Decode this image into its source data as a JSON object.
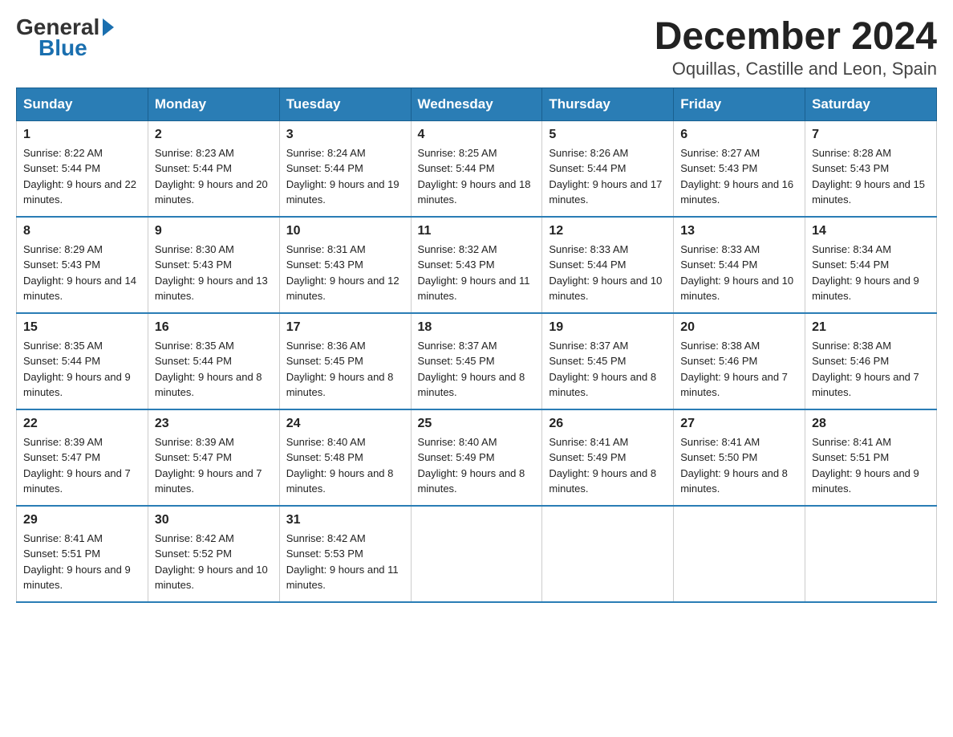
{
  "logo": {
    "general": "General",
    "arrow": "▶",
    "blue": "Blue"
  },
  "title": "December 2024",
  "subtitle": "Oquillas, Castille and Leon, Spain",
  "days_of_week": [
    "Sunday",
    "Monday",
    "Tuesday",
    "Wednesday",
    "Thursday",
    "Friday",
    "Saturday"
  ],
  "weeks": [
    [
      {
        "day": "1",
        "sunrise": "8:22 AM",
        "sunset": "5:44 PM",
        "daylight": "9 hours and 22 minutes."
      },
      {
        "day": "2",
        "sunrise": "8:23 AM",
        "sunset": "5:44 PM",
        "daylight": "9 hours and 20 minutes."
      },
      {
        "day": "3",
        "sunrise": "8:24 AM",
        "sunset": "5:44 PM",
        "daylight": "9 hours and 19 minutes."
      },
      {
        "day": "4",
        "sunrise": "8:25 AM",
        "sunset": "5:44 PM",
        "daylight": "9 hours and 18 minutes."
      },
      {
        "day": "5",
        "sunrise": "8:26 AM",
        "sunset": "5:44 PM",
        "daylight": "9 hours and 17 minutes."
      },
      {
        "day": "6",
        "sunrise": "8:27 AM",
        "sunset": "5:43 PM",
        "daylight": "9 hours and 16 minutes."
      },
      {
        "day": "7",
        "sunrise": "8:28 AM",
        "sunset": "5:43 PM",
        "daylight": "9 hours and 15 minutes."
      }
    ],
    [
      {
        "day": "8",
        "sunrise": "8:29 AM",
        "sunset": "5:43 PM",
        "daylight": "9 hours and 14 minutes."
      },
      {
        "day": "9",
        "sunrise": "8:30 AM",
        "sunset": "5:43 PM",
        "daylight": "9 hours and 13 minutes."
      },
      {
        "day": "10",
        "sunrise": "8:31 AM",
        "sunset": "5:43 PM",
        "daylight": "9 hours and 12 minutes."
      },
      {
        "day": "11",
        "sunrise": "8:32 AM",
        "sunset": "5:43 PM",
        "daylight": "9 hours and 11 minutes."
      },
      {
        "day": "12",
        "sunrise": "8:33 AM",
        "sunset": "5:44 PM",
        "daylight": "9 hours and 10 minutes."
      },
      {
        "day": "13",
        "sunrise": "8:33 AM",
        "sunset": "5:44 PM",
        "daylight": "9 hours and 10 minutes."
      },
      {
        "day": "14",
        "sunrise": "8:34 AM",
        "sunset": "5:44 PM",
        "daylight": "9 hours and 9 minutes."
      }
    ],
    [
      {
        "day": "15",
        "sunrise": "8:35 AM",
        "sunset": "5:44 PM",
        "daylight": "9 hours and 9 minutes."
      },
      {
        "day": "16",
        "sunrise": "8:35 AM",
        "sunset": "5:44 PM",
        "daylight": "9 hours and 8 minutes."
      },
      {
        "day": "17",
        "sunrise": "8:36 AM",
        "sunset": "5:45 PM",
        "daylight": "9 hours and 8 minutes."
      },
      {
        "day": "18",
        "sunrise": "8:37 AM",
        "sunset": "5:45 PM",
        "daylight": "9 hours and 8 minutes."
      },
      {
        "day": "19",
        "sunrise": "8:37 AM",
        "sunset": "5:45 PM",
        "daylight": "9 hours and 8 minutes."
      },
      {
        "day": "20",
        "sunrise": "8:38 AM",
        "sunset": "5:46 PM",
        "daylight": "9 hours and 7 minutes."
      },
      {
        "day": "21",
        "sunrise": "8:38 AM",
        "sunset": "5:46 PM",
        "daylight": "9 hours and 7 minutes."
      }
    ],
    [
      {
        "day": "22",
        "sunrise": "8:39 AM",
        "sunset": "5:47 PM",
        "daylight": "9 hours and 7 minutes."
      },
      {
        "day": "23",
        "sunrise": "8:39 AM",
        "sunset": "5:47 PM",
        "daylight": "9 hours and 7 minutes."
      },
      {
        "day": "24",
        "sunrise": "8:40 AM",
        "sunset": "5:48 PM",
        "daylight": "9 hours and 8 minutes."
      },
      {
        "day": "25",
        "sunrise": "8:40 AM",
        "sunset": "5:49 PM",
        "daylight": "9 hours and 8 minutes."
      },
      {
        "day": "26",
        "sunrise": "8:41 AM",
        "sunset": "5:49 PM",
        "daylight": "9 hours and 8 minutes."
      },
      {
        "day": "27",
        "sunrise": "8:41 AM",
        "sunset": "5:50 PM",
        "daylight": "9 hours and 8 minutes."
      },
      {
        "day": "28",
        "sunrise": "8:41 AM",
        "sunset": "5:51 PM",
        "daylight": "9 hours and 9 minutes."
      }
    ],
    [
      {
        "day": "29",
        "sunrise": "8:41 AM",
        "sunset": "5:51 PM",
        "daylight": "9 hours and 9 minutes."
      },
      {
        "day": "30",
        "sunrise": "8:42 AM",
        "sunset": "5:52 PM",
        "daylight": "9 hours and 10 minutes."
      },
      {
        "day": "31",
        "sunrise": "8:42 AM",
        "sunset": "5:53 PM",
        "daylight": "9 hours and 11 minutes."
      },
      null,
      null,
      null,
      null
    ]
  ]
}
